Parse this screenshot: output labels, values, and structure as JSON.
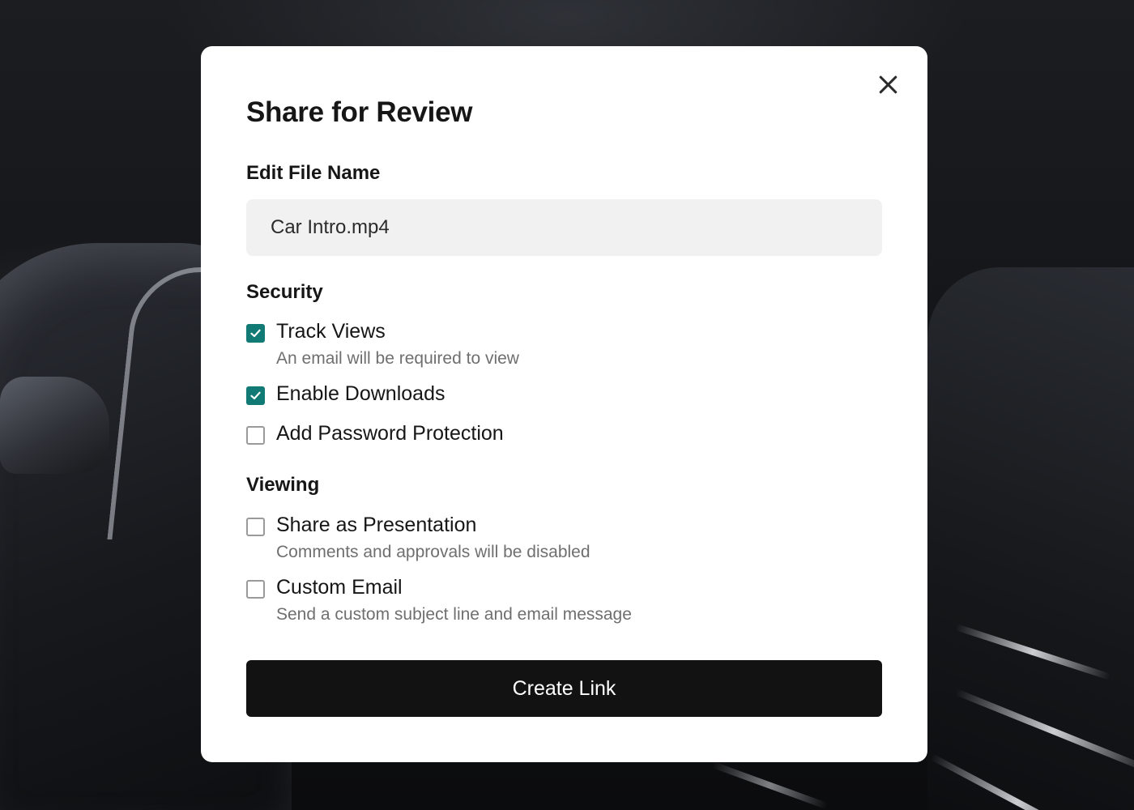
{
  "modal": {
    "title": "Share for Review",
    "close_icon": "close-icon"
  },
  "file_name": {
    "label": "Edit File Name",
    "value": "Car Intro.mp4"
  },
  "security": {
    "label": "Security",
    "options": [
      {
        "label": "Track Views",
        "description": "An email will be required to view",
        "checked": true
      },
      {
        "label": "Enable Downloads",
        "description": "",
        "checked": true
      },
      {
        "label": "Add Password Protection",
        "description": "",
        "checked": false
      }
    ]
  },
  "viewing": {
    "label": "Viewing",
    "options": [
      {
        "label": "Share as Presentation",
        "description": "Comments and approvals will be disabled",
        "checked": false
      },
      {
        "label": "Custom Email",
        "description": "Send a custom subject line and email message",
        "checked": false
      }
    ]
  },
  "actions": {
    "create_link_label": "Create Link"
  },
  "colors": {
    "checkbox_checked": "#127a74",
    "primary_button": "#121212",
    "input_background": "#f1f1f1"
  }
}
